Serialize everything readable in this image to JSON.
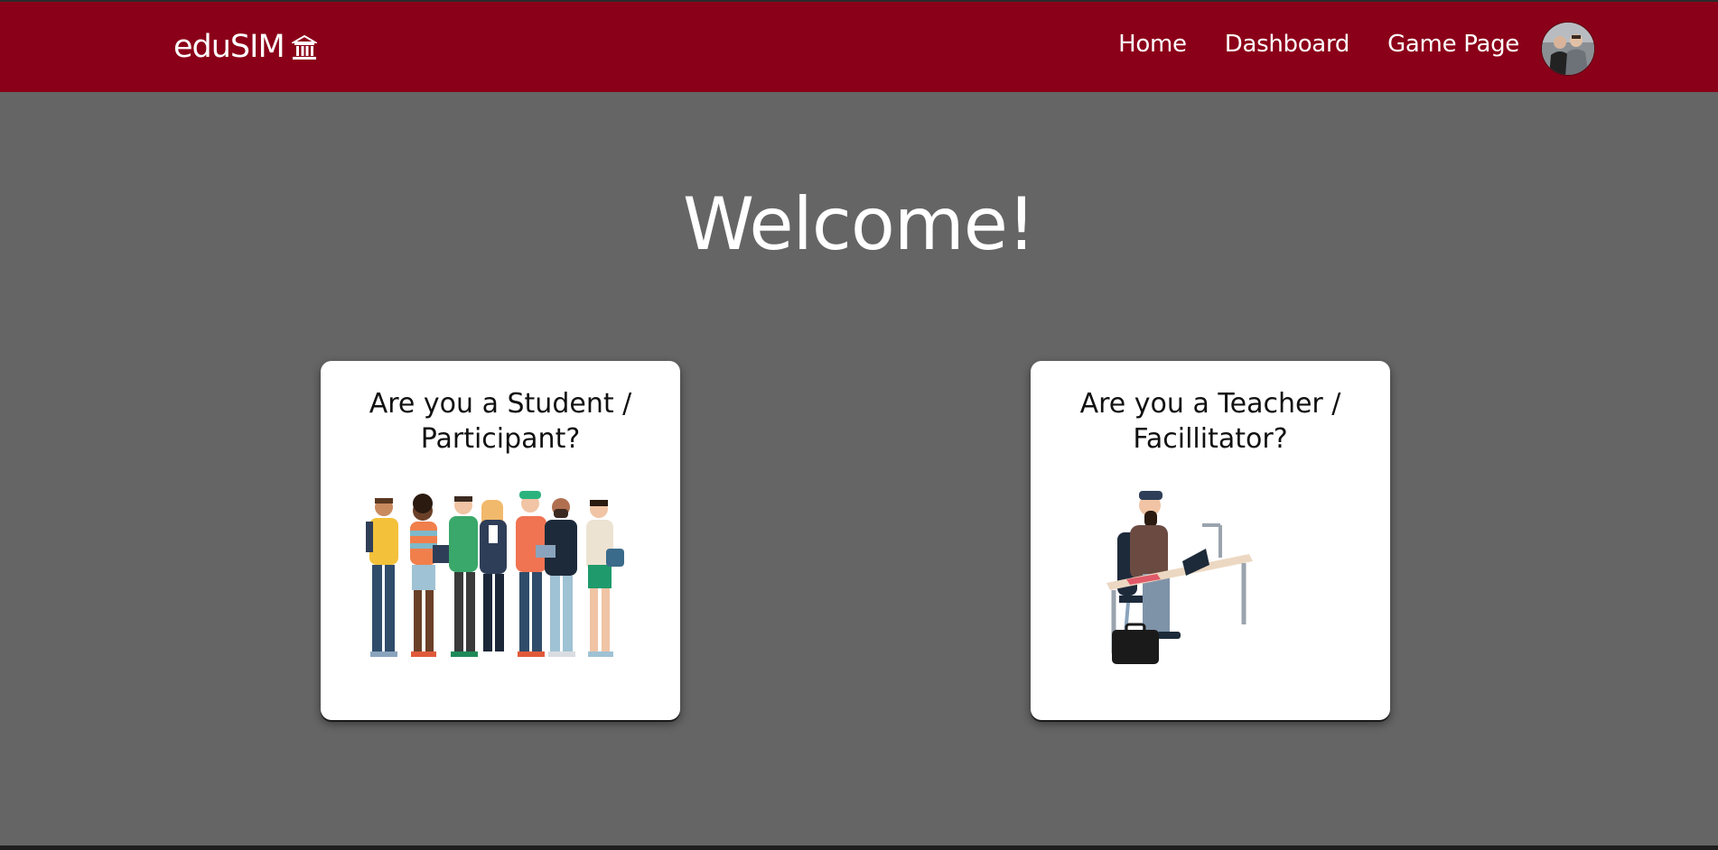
{
  "navbar": {
    "brand": "eduSIM",
    "brand_icon": "institution-icon",
    "links": [
      {
        "label": "Home"
      },
      {
        "label": "Dashboard"
      },
      {
        "label": "Game Page"
      }
    ],
    "avatar_icon": "user-avatar"
  },
  "main": {
    "heading": "Welcome!"
  },
  "cards": {
    "student": {
      "title": "Are you a Student / Participant?",
      "illustration": "students-group-illustration"
    },
    "teacher": {
      "title": "Are you a Teacher / Facillitator?",
      "illustration": "teacher-at-desk-illustration"
    }
  },
  "colors": {
    "navbar": "#8b0019",
    "background": "#656565",
    "card": "#ffffff",
    "heading_text": "#ffffff"
  }
}
